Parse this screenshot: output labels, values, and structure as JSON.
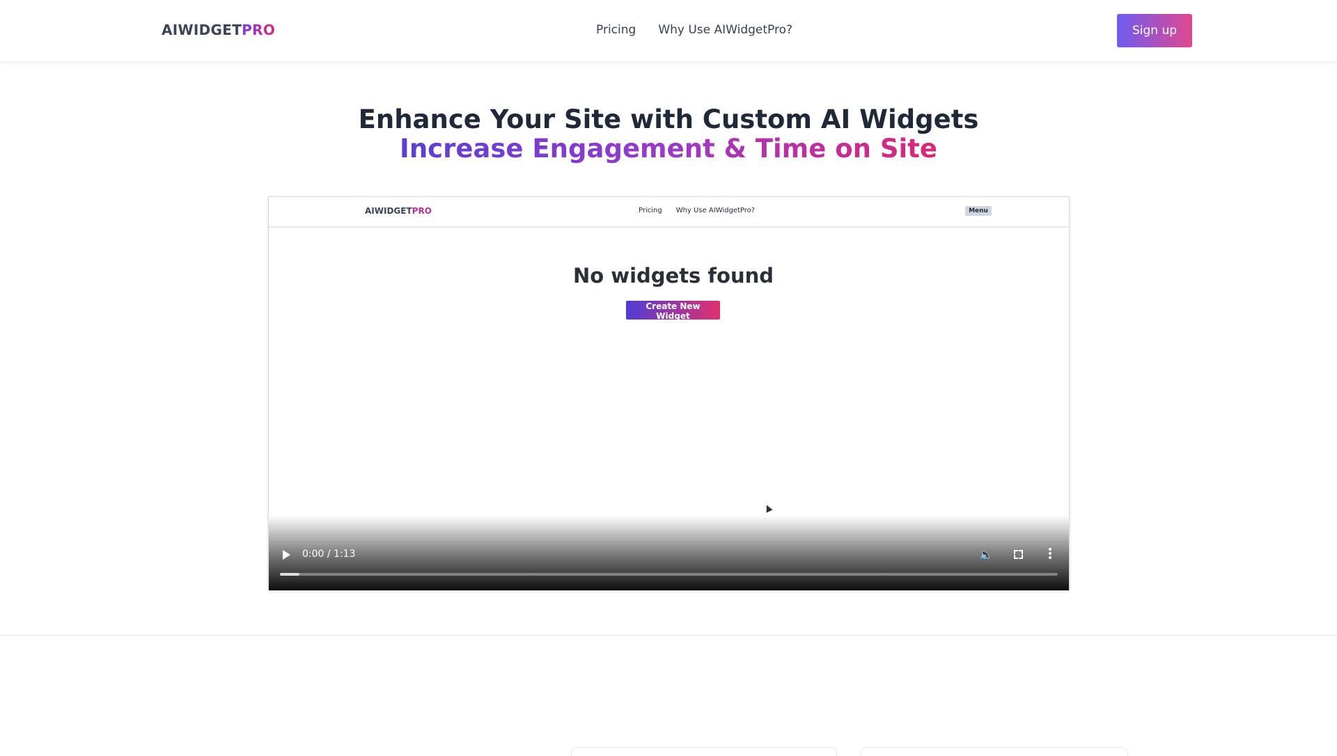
{
  "header": {
    "logo_main": "AIWIDGET",
    "logo_accent": "PRO",
    "nav": [
      {
        "label": "Pricing"
      },
      {
        "label": "Why Use AIWidgetPro?"
      }
    ],
    "signup_label": "Sign up"
  },
  "hero": {
    "line1": "Enhance Your Site with Custom AI Widgets",
    "line2": "Increase Engagement & Time on Site"
  },
  "video": {
    "preview": {
      "logo_main": "AIWIDGET",
      "logo_accent": "PRO",
      "nav": [
        {
          "label": "Pricing"
        },
        {
          "label": "Why Use AIWidgetPro?"
        }
      ],
      "menu_label": "Menu",
      "empty_title": "No widgets found",
      "create_label": "Create New Widget"
    },
    "time": "0:00 / 1:13",
    "progress_fraction": 0.025
  },
  "colors": {
    "accent_start": "#6d5cf0",
    "accent_end": "#e0488f",
    "text_dark": "#1f2937"
  }
}
